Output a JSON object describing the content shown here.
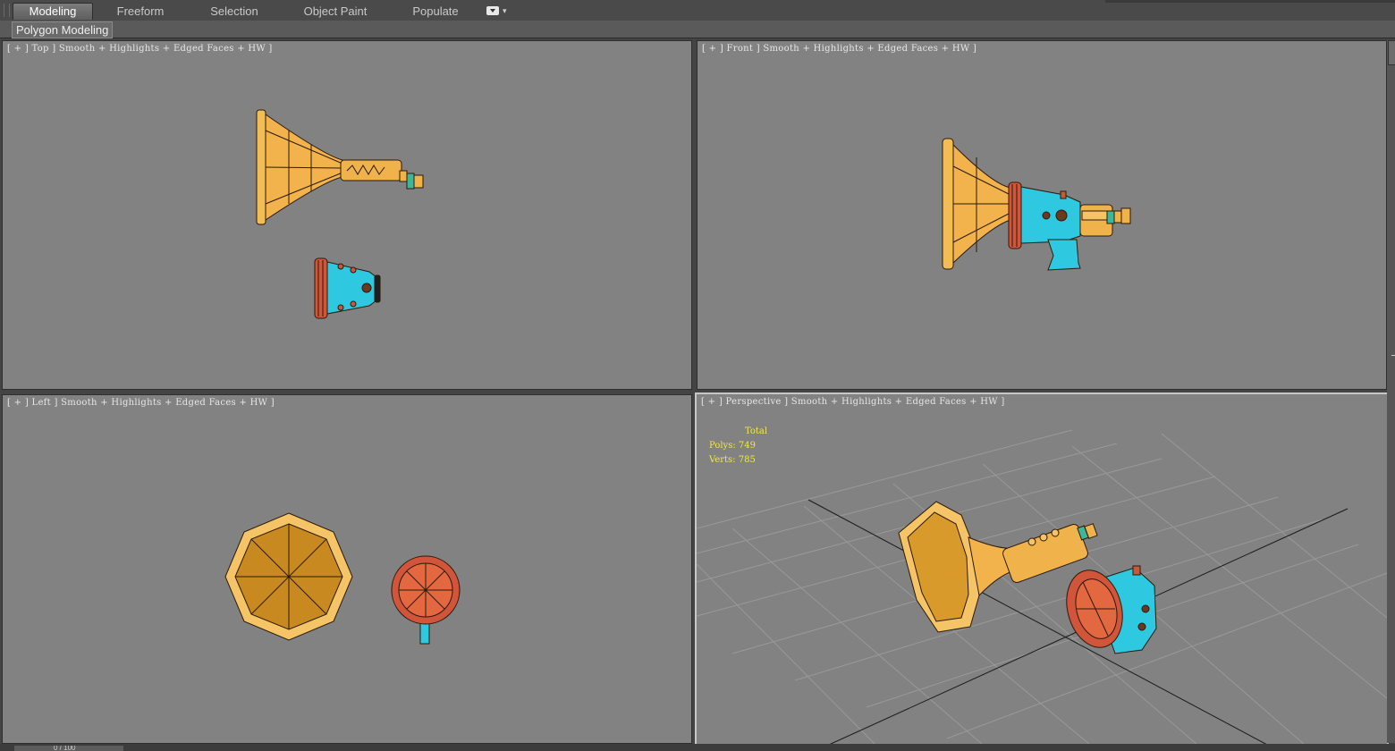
{
  "ribbon": {
    "tabs": [
      {
        "label": "Modeling",
        "active": true
      },
      {
        "label": "Freeform",
        "active": false
      },
      {
        "label": "Selection",
        "active": false
      },
      {
        "label": "Object Paint",
        "active": false
      },
      {
        "label": "Populate",
        "active": false
      }
    ]
  },
  "panel": {
    "label": "Polygon Modeling"
  },
  "viewports": {
    "top": {
      "label": "[ + ] Top ] Smooth + Highlights + Edged Faces + HW ]"
    },
    "front": {
      "label": "[ + ] Front ] Smooth + Highlights + Edged Faces + HW ]"
    },
    "left": {
      "label": "[ + ] Left ] Smooth + Highlights + Edged Faces + HW ]"
    },
    "perspective": {
      "label": "[ + ] Perspective ] Smooth + Highlights + Edged Faces + HW ]"
    }
  },
  "stats": {
    "heading": "Total",
    "polys_label": "Polys:",
    "polys": "749",
    "verts_label": "Verts:",
    "verts": "785"
  },
  "timeslider": {
    "value": "0 / 100"
  },
  "colors": {
    "viewport_bg": "#828282",
    "horn_gold": "#f0b24a",
    "body_cyan": "#2ec8e0",
    "rim_red": "#d0553a",
    "stats_yellow": "#f2e64a"
  }
}
